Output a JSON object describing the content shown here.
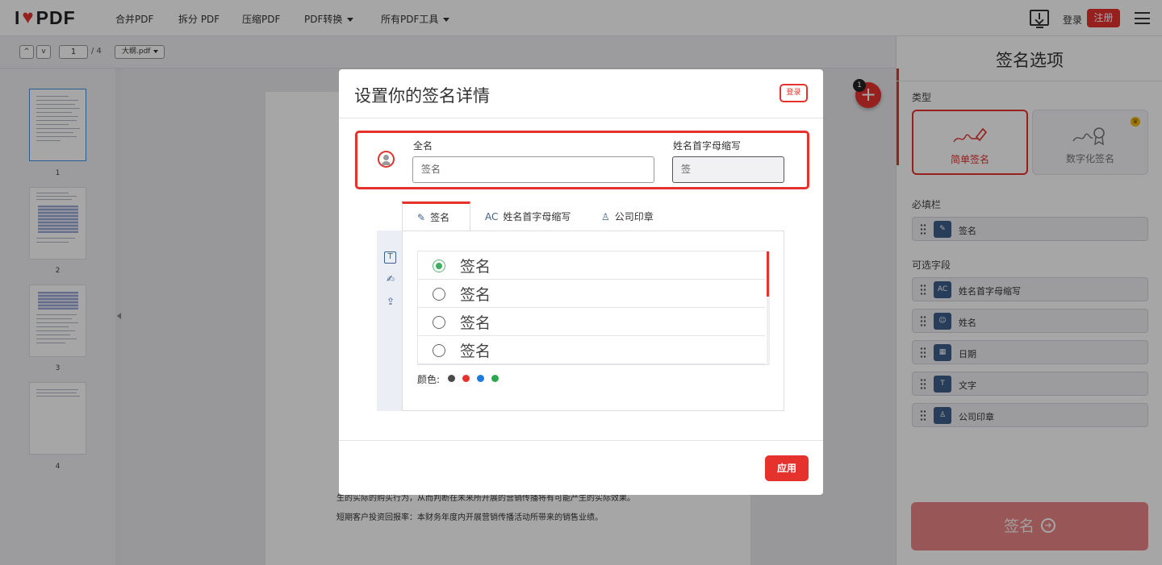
{
  "nav": {
    "logo_left": "I",
    "logo_right": "PDF",
    "items": [
      "合并PDF",
      "拆分 PDF",
      "压缩PDF",
      "PDF转换",
      "所有PDF工具"
    ],
    "login": "登录",
    "register": "注册"
  },
  "toolbar": {
    "prev": "^",
    "next": "v",
    "page_value": "1",
    "page_total": "/ 4",
    "file_name": "大纲.pdf"
  },
  "thumbnails": [
    "1",
    "2",
    "3",
    "4"
  ],
  "document": {
    "lines": [
      "生的实际的购买行为，从而判断在未来所开展的营销传播将有可能产生的实际效果。",
      "短期客户投资回报率：本财务年度内开展营销传播活动所带来的销售业绩。"
    ]
  },
  "fab": {
    "badge": "1",
    "icon": "plus-icon"
  },
  "right_panel": {
    "title": "签名选项",
    "type_label": "类型",
    "types": [
      {
        "label": "简单签名",
        "selected": true
      },
      {
        "label": "数字化签名",
        "selected": false
      }
    ],
    "required_label": "必填栏",
    "required_fields": [
      {
        "label": "签名",
        "icon": "pen-icon"
      }
    ],
    "optional_label": "可选字段",
    "optional_fields": [
      {
        "label": "姓名首字母缩写",
        "icon": "initials-icon"
      },
      {
        "label": "姓名",
        "icon": "person-icon"
      },
      {
        "label": "日期",
        "icon": "calendar-icon"
      },
      {
        "label": "文字",
        "icon": "text-icon"
      },
      {
        "label": "公司印章",
        "icon": "stamp-icon"
      }
    ],
    "sign_button": "签名"
  },
  "modal": {
    "title": "设置你的签名详情",
    "login": "登录",
    "full_name_label": "全名",
    "full_name_placeholder": "签名",
    "initials_label": "姓名首字母缩写",
    "initials_value": "签",
    "tabs": [
      "签名",
      "姓名首字母缩写",
      "公司印章"
    ],
    "signatures": [
      {
        "text": "签名",
        "selected": true
      },
      {
        "text": "签名",
        "selected": false
      },
      {
        "text": "签名",
        "selected": false
      },
      {
        "text": "签名",
        "selected": false
      }
    ],
    "color_label": "颜色:",
    "colors": [
      "#4a4a4a",
      "#e5322d",
      "#1e7be0",
      "#2ea84f"
    ],
    "apply": "应用"
  },
  "colors": {
    "accent": "#e5322d",
    "icon_blue": "#3e5f8a"
  }
}
